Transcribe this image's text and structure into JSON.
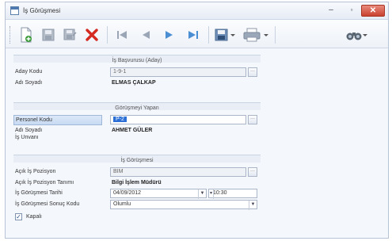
{
  "window": {
    "title": "İş Görüşmesi",
    "min_glyph": "–",
    "max_glyph": "▫",
    "close_glyph": "✕"
  },
  "toolbar": {
    "buttons": [
      {
        "name": "new",
        "icon": "new-document-icon"
      },
      {
        "name": "save",
        "icon": "save-icon"
      },
      {
        "name": "save-as",
        "icon": "save-as-icon"
      },
      {
        "name": "delete",
        "icon": "delete-icon"
      },
      {
        "name": "first",
        "icon": "first-record-icon"
      },
      {
        "name": "previous",
        "icon": "previous-record-icon"
      },
      {
        "name": "next",
        "icon": "next-record-icon"
      },
      {
        "name": "last",
        "icon": "last-record-icon"
      },
      {
        "name": "export",
        "icon": "export-icon"
      },
      {
        "name": "print",
        "icon": "printer-icon"
      },
      {
        "name": "find",
        "icon": "binoculars-icon"
      }
    ],
    "colors": {
      "green": "#3a9a3a",
      "red": "#d42a20",
      "blue": "#4a8fd4",
      "gray": "#9aa6b6"
    }
  },
  "sections": {
    "application": "İş Başvurusu (Aday)",
    "interviewer": "Görüşmeyi Yapan",
    "interview": "İş Görüşmesi"
  },
  "fields": {
    "candidate_code": {
      "label": "Aday Kodu",
      "value": "1-9-1"
    },
    "candidate_name": {
      "label": "Adı Soyadı",
      "value": "ELMAS ÇALKAP"
    },
    "staff_code": {
      "label": "Personel Kodu",
      "value": "P-2"
    },
    "staff_name": {
      "label": "Adı Soyadı",
      "value": "AHMET GÜLER"
    },
    "staff_title": {
      "label": "İş Unvanı",
      "value": ""
    },
    "position": {
      "label": "Açık İş Pozisyon",
      "value": "BIM"
    },
    "position_desc": {
      "label": "Açık İş Pozisyon Tanımı",
      "value": "Bilgi İşlem Müdürü"
    },
    "interview_date": {
      "label": "İş Görüşmesi Tarihi",
      "date": "04/09/2012",
      "time": "10:30"
    },
    "result_code": {
      "label": "İş Görüşmesi Sonuç Kodu",
      "value": "Olumlu"
    },
    "closed": {
      "label": "Kapalı",
      "checked": true
    }
  },
  "glyphs": {
    "ellipsis": "···",
    "dropdown": "▼",
    "check": "✓",
    "dropdown_small": "▾"
  }
}
